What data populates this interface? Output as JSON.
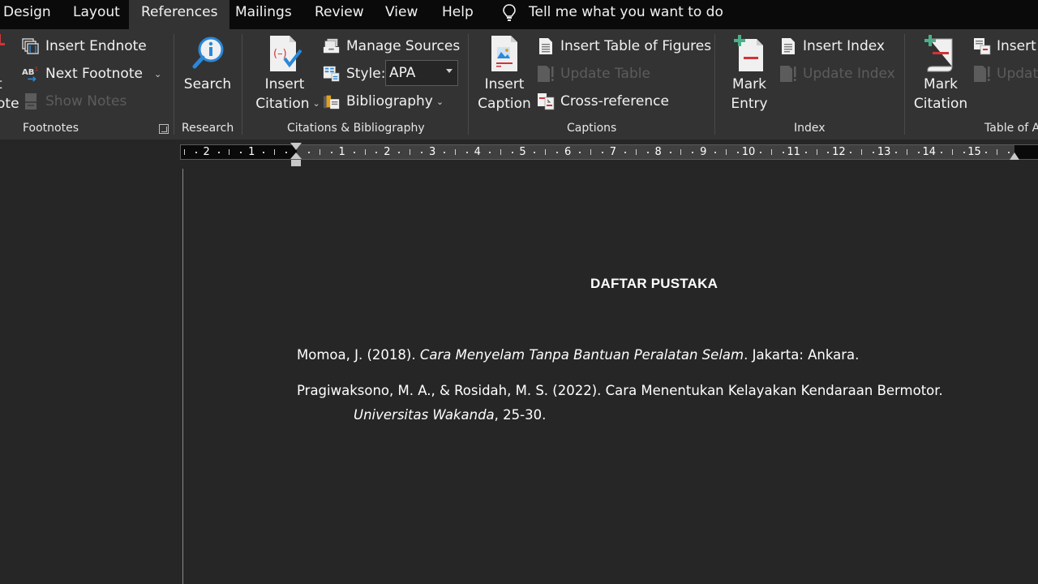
{
  "tabs": [
    {
      "label": "Design",
      "active": false
    },
    {
      "label": "Layout",
      "active": false
    },
    {
      "label": "References",
      "active": true
    },
    {
      "label": "Mailings",
      "active": false
    },
    {
      "label": "Review",
      "active": false
    },
    {
      "label": "View",
      "active": false
    },
    {
      "label": "Help",
      "active": false
    }
  ],
  "tell_me": {
    "placeholder": "Tell me what you want to do",
    "icon": "lightbulb-icon"
  },
  "ribbon": {
    "footnotes": {
      "label": "Footnotes",
      "partial_big_button_lines": [
        "t",
        "ote"
      ],
      "insert_endnote": "Insert Endnote",
      "next_footnote": "Next Footnote",
      "show_notes": "Show Notes"
    },
    "research": {
      "label": "Research",
      "search": "Search"
    },
    "citations": {
      "label": "Citations & Bibliography",
      "insert_citation_line1": "Insert",
      "insert_citation_line2": "Citation",
      "manage_sources": "Manage Sources",
      "style_label": "Style:",
      "style_value": "APA",
      "bibliography": "Bibliography"
    },
    "captions": {
      "label": "Captions",
      "insert_caption_line1": "Insert",
      "insert_caption_line2": "Caption",
      "insert_table_of_figures": "Insert Table of Figures",
      "update_table": "Update Table",
      "cross_reference": "Cross-reference"
    },
    "index": {
      "label": "Index",
      "mark_entry_line1": "Mark",
      "mark_entry_line2": "Entry",
      "insert_index": "Insert Index",
      "update_index": "Update Index"
    },
    "table_of_authorities": {
      "label": "Table of A",
      "mark_citation_line1": "Mark",
      "mark_citation_line2": "Citation",
      "insert_table": "Insert T",
      "update": "Update"
    }
  },
  "ruler": {
    "left_numbers": [
      "2",
      "1"
    ],
    "right_numbers": [
      "1",
      "2",
      "3",
      "4",
      "5",
      "6",
      "7",
      "8",
      "9",
      "10",
      "11",
      "12",
      "13",
      "14",
      "15"
    ]
  },
  "document": {
    "title": "DAFTAR PUSTAKA",
    "references": [
      {
        "lines": [
          [
            {
              "text": "Momoa, J. (2018). ",
              "italic": false
            },
            {
              "text": "Cara Menyelam Tanpa Bantuan Peralatan Selam",
              "italic": true
            },
            {
              "text": ". Jakarta: Ankara.",
              "italic": false
            }
          ]
        ]
      },
      {
        "lines": [
          [
            {
              "text": "Pragiwaksono, M. A., & Rosidah, M. S. (2022). Cara Menentukan Kelayakan Kendaraan Bermotor.",
              "italic": false
            }
          ],
          [
            {
              "text": "Universitas Wakanda",
              "italic": true
            },
            {
              "text": ", 25-30.",
              "italic": false
            }
          ]
        ]
      }
    ]
  },
  "colors": {
    "tabbar_bg": "#0a0a0a",
    "ribbon_bg": "#333333",
    "document_bg": "#262626",
    "text": "#ffffff",
    "disabled_text": "#5c5c5c",
    "accent_blue": "#2b88d8",
    "accent_red": "#d13438",
    "accent_green": "#4caf8a"
  }
}
